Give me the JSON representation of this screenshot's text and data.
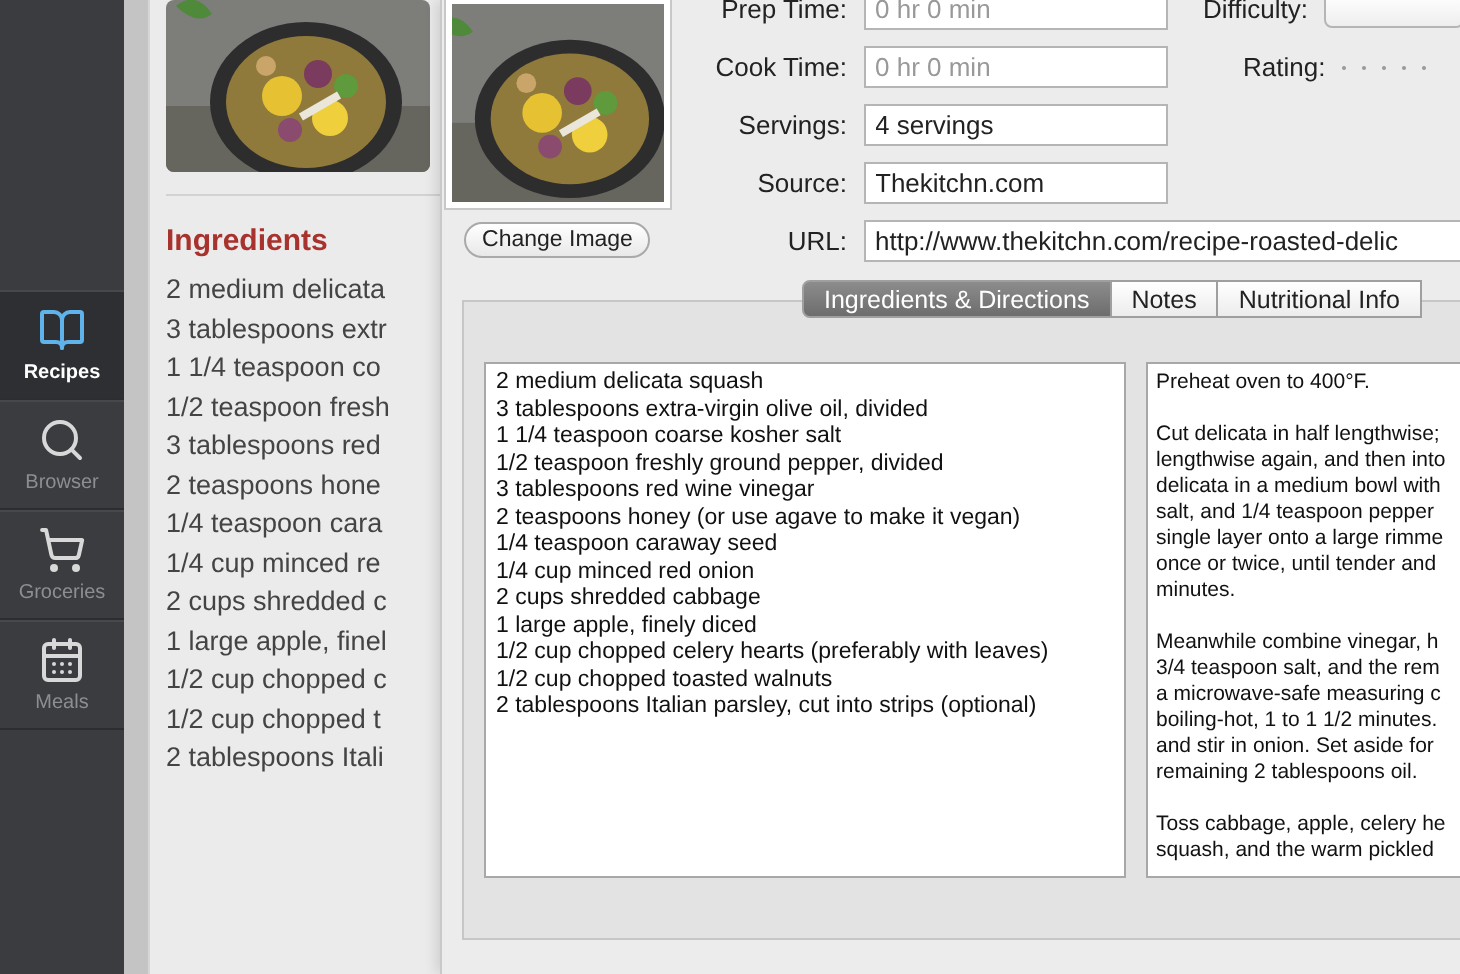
{
  "sidebar": {
    "items": [
      {
        "label": "Recipes",
        "selected": true
      },
      {
        "label": "Browser",
        "selected": false
      },
      {
        "label": "Groceries",
        "selected": false
      },
      {
        "label": "Meals",
        "selected": false
      }
    ]
  },
  "recipe": {
    "ingredients_heading": "Ingredients",
    "ingredients": [
      "2 medium delicata",
      "3 tablespoons extr",
      "1 1/4 teaspoon co",
      "1/2 teaspoon fresh",
      "3 tablespoons red",
      "2 teaspoons hone",
      "1/4 teaspoon cara",
      "1/4 cup minced re",
      "2 cups shredded c",
      "1 large apple, finel",
      "1/2 cup chopped c",
      "1/2 cup chopped t",
      "2 tablespoons Itali"
    ]
  },
  "editor": {
    "change_image_button": "Change Image",
    "fields": [
      {
        "label": "Prep Time:",
        "placeholder": "0 hr 0 min"
      },
      {
        "label": "Cook Time:",
        "placeholder": "0 hr 0 min"
      },
      {
        "label": "Servings:",
        "value": "4 servings"
      },
      {
        "label": "Source:",
        "value": "Thekitchn.com"
      }
    ],
    "difficulty": {
      "label": "Difficulty:"
    },
    "rating": {
      "label": "Rating:",
      "stars": 0
    },
    "url": {
      "label": "URL:",
      "value": "http://www.thekitchn.com/recipe-roasted-delic"
    },
    "tabs": [
      {
        "label": "Ingredients & Directions",
        "selected": true
      },
      {
        "label": "Notes",
        "selected": false
      },
      {
        "label": "Nutritional Info",
        "selected": false
      }
    ],
    "ingredients": [
      "2 medium delicata squash",
      "3 tablespoons extra-virgin olive oil, divided",
      "1 1/4 teaspoon coarse kosher salt",
      "1/2 teaspoon freshly ground pepper, divided",
      "3 tablespoons red wine vinegar",
      "2 teaspoons honey (or use agave to make it vegan)",
      "1/4 teaspoon caraway seed",
      "1/4 cup minced red onion",
      "2 cups shredded cabbage",
      "1 large apple, finely diced",
      "1/2 cup chopped celery hearts (preferably with leaves)",
      "1/2 cup chopped toasted walnuts",
      "2 tablespoons Italian parsley, cut into strips (optional)"
    ],
    "directions": [
      {
        "lines": [
          "Preheat oven to 400°F."
        ]
      },
      {
        "lines": [
          "Cut delicata in half lengthwise;",
          "lengthwise again, and then into",
          "delicata in a medium bowl with",
          "salt, and 1/4 teaspoon pepper",
          "single layer onto a large rimme",
          "once or twice, until tender and",
          "minutes."
        ]
      },
      {
        "lines": [
          "Meanwhile combine vinegar, h",
          "3/4 teaspoon salt, and the rem",
          "a microwave-safe measuring c",
          "boiling-hot, 1 to 1 1/2 minutes.",
          "and stir in onion. Set aside for",
          "remaining 2 tablespoons oil."
        ]
      },
      {
        "lines": [
          "Toss cabbage, apple, celery he",
          "squash, and the warm pickled"
        ]
      }
    ]
  }
}
